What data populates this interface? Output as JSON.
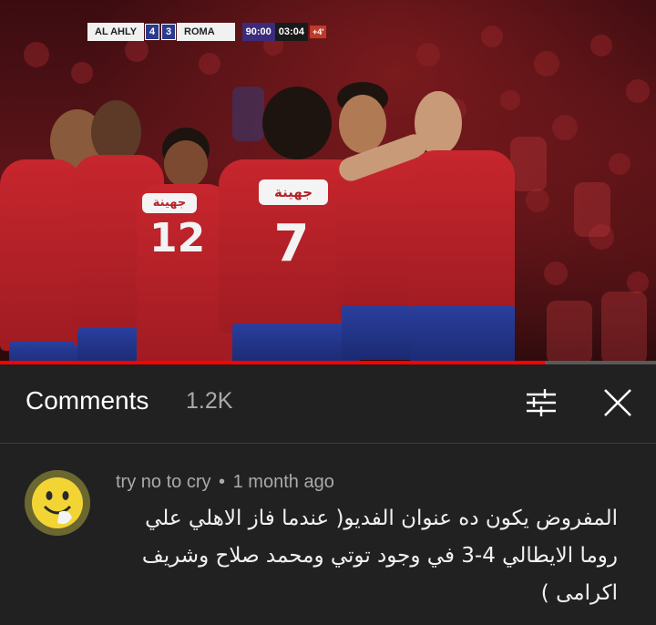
{
  "video": {
    "scoreboard": {
      "home_team": "AL AHLY",
      "home_score": "4",
      "away_score": "3",
      "away_team": "ROMA",
      "clock": "90:00",
      "added_time": "03:04",
      "extra": "+4'"
    },
    "player_numbers": [
      "12",
      "7"
    ],
    "sponsor_text": "جهينة",
    "progress_fraction": 0.83,
    "colors": {
      "progress": "#ff0000",
      "jersey": "#c7262d",
      "shorts": "#2a3f9e"
    }
  },
  "comments": {
    "title": "Comments",
    "count": "1.2K",
    "filter_icon": "sort-filter-icon",
    "close_icon": "close-icon"
  },
  "comment": {
    "author": "try no to cry",
    "separator": "•",
    "time": "1 month ago",
    "avatar_icon": "smiley-face-avatar",
    "lines": [
      "المفروض يكون ده عنوان الفديو( عندما فاز الاهلي علي",
      "روما الايطالي 4-3 في وجود توتي ومحمد صلاح وشريف",
      "اكرامى )"
    ]
  }
}
